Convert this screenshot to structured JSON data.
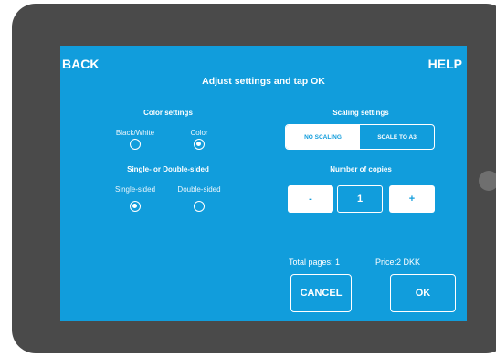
{
  "header": {
    "back_label": "BACK",
    "help_label": "HELP",
    "title": "Adjust settings and tap OK"
  },
  "color_settings": {
    "heading": "Color settings",
    "options": [
      {
        "label": "Black/White",
        "selected": false
      },
      {
        "label": "Color",
        "selected": true
      }
    ]
  },
  "sides_settings": {
    "heading": "Single- or Double-sided",
    "options": [
      {
        "label": "Single-sided",
        "selected": true
      },
      {
        "label": "Double-sided",
        "selected": false
      }
    ]
  },
  "scaling_settings": {
    "heading": "Scaling settings",
    "options": [
      {
        "label": "NO SCALING",
        "selected": true
      },
      {
        "label": "SCALE TO A3",
        "selected": false
      }
    ]
  },
  "copies": {
    "heading": "Number of copies",
    "minus_label": "-",
    "value": "1",
    "plus_label": "+"
  },
  "summary": {
    "total_pages": "Total pages: 1",
    "price": "Price:2 DKK"
  },
  "actions": {
    "cancel_label": "CANCEL",
    "ok_label": "OK"
  },
  "colors": {
    "screen_blue": "#119ddc",
    "bezel": "#4a4a4a",
    "foreground": "#ffffff"
  }
}
